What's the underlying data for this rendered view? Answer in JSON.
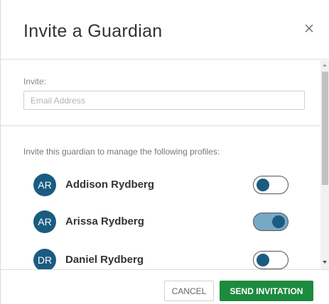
{
  "dialog": {
    "title": "Invite a Guardian",
    "close_icon": "close-icon"
  },
  "invite": {
    "label": "Invite:",
    "email_placeholder": "Email Address",
    "email_value": ""
  },
  "profiles": {
    "label": "Invite this guardian to manage the following profiles:",
    "items": [
      {
        "initials": "AR",
        "name": "Addison Rydberg",
        "enabled": false
      },
      {
        "initials": "AR",
        "name": "Arissa Rydberg",
        "enabled": true
      },
      {
        "initials": "DR",
        "name": "Daniel Rydberg",
        "enabled": false
      }
    ]
  },
  "footer": {
    "cancel_label": "CANCEL",
    "send_label": "SEND INVITATION"
  },
  "colors": {
    "avatar": "#1a5c80",
    "toggle_on_track": "#78a9c4",
    "send_button": "#1d8b3e"
  }
}
